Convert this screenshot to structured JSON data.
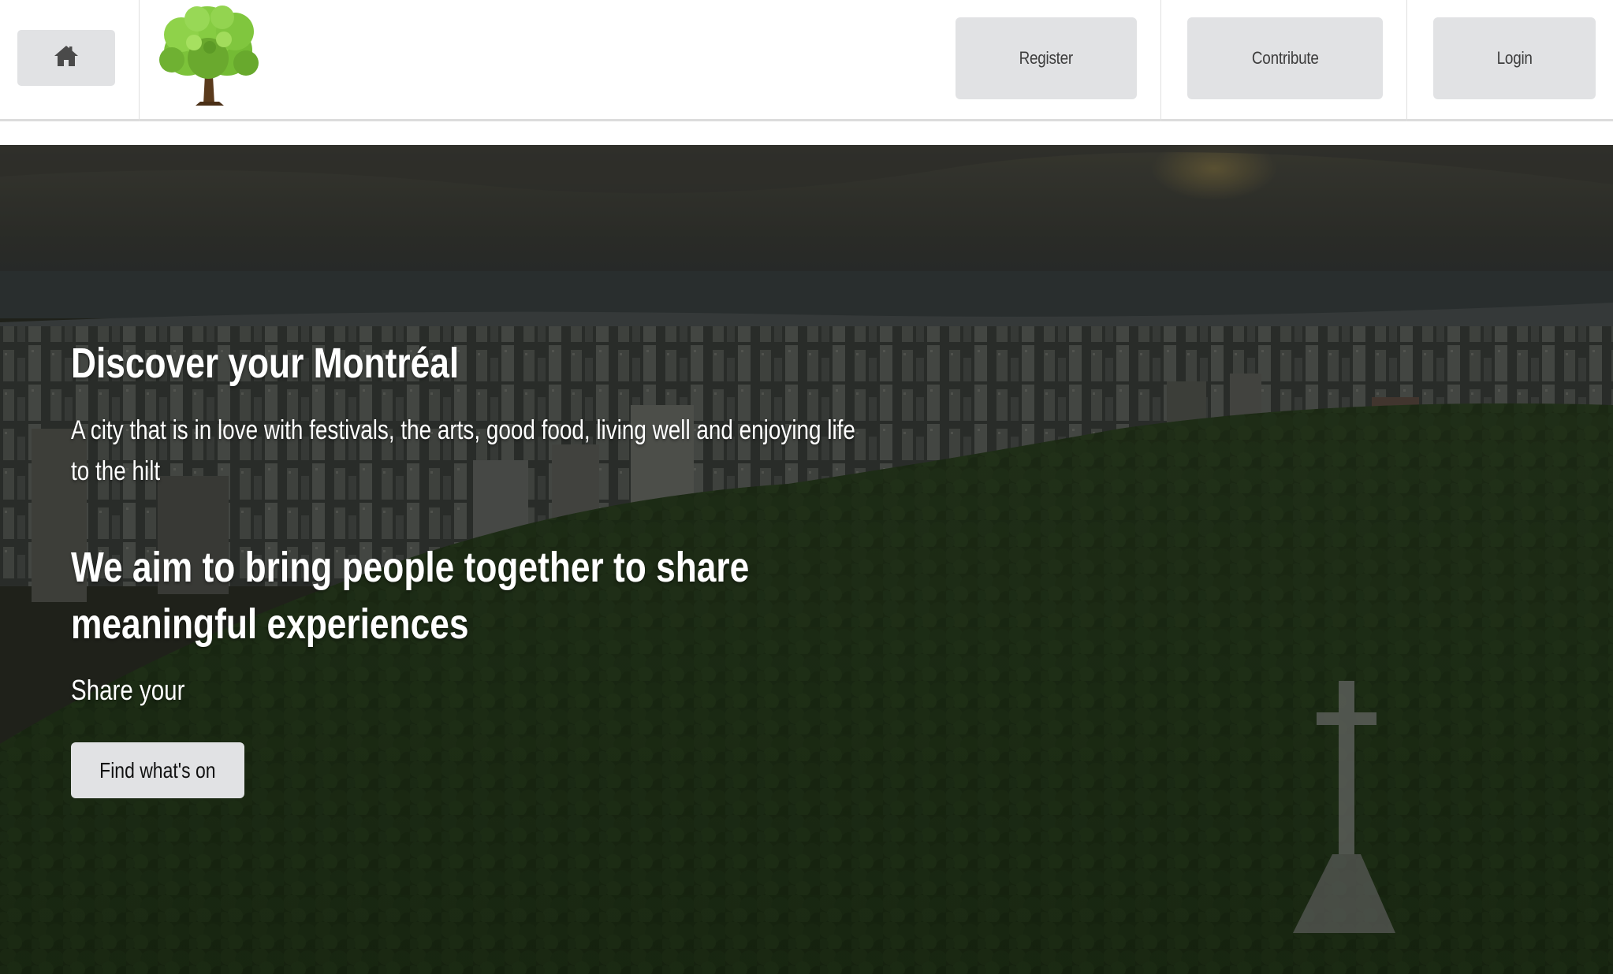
{
  "header": {
    "home_icon": "home-icon",
    "logo_icon": "tree-icon",
    "register_label": "Register",
    "contribute_label": "Contribute",
    "login_label": "Login"
  },
  "hero": {
    "title": "Discover your Montréal",
    "subtitle": "A city that is in love with festivals, the arts, good food, living well and enjoying life to the hilt",
    "aim": "We aim to bring people together to share meaningful experiences",
    "share": "Share your",
    "cta_label": "Find what's on"
  },
  "colors": {
    "button_bg": "#e1e2e4",
    "hero_text": "#ffffff",
    "header_bg": "#ffffff"
  }
}
